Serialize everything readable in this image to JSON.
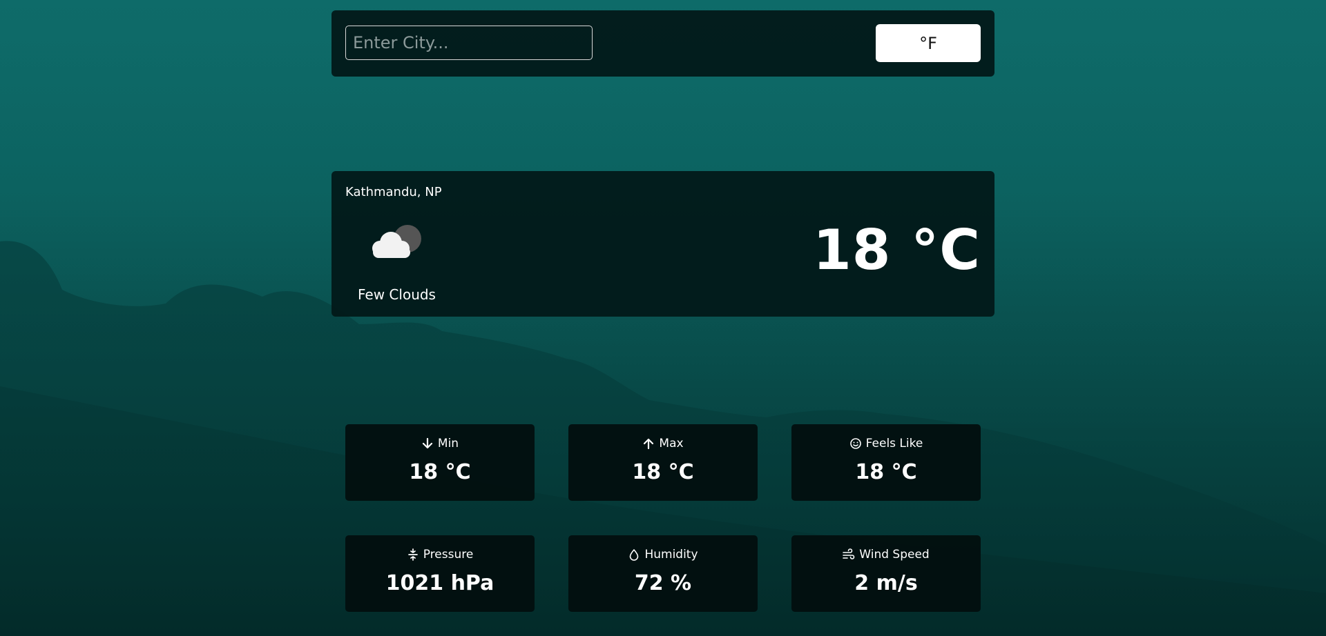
{
  "search": {
    "placeholder": "Enter City...",
    "value": ""
  },
  "unit_toggle": {
    "label": "°F"
  },
  "current": {
    "location": "Kathmandu, NP",
    "condition": "Few Clouds",
    "temperature": "18 °C",
    "icon": "few-clouds-night-icon"
  },
  "stats": [
    {
      "label": "Min",
      "value": "18 °C",
      "icon": "arrow-down-icon"
    },
    {
      "label": "Max",
      "value": "18 °C",
      "icon": "arrow-up-icon"
    },
    {
      "label": "Feels Like",
      "value": "18 °C",
      "icon": "smiley-icon"
    },
    {
      "label": "Pressure",
      "value": "1021 hPa",
      "icon": "pressure-icon"
    },
    {
      "label": "Humidity",
      "value": "72 %",
      "icon": "droplet-icon"
    },
    {
      "label": "Wind Speed",
      "value": "2 m/s",
      "icon": "wind-icon"
    }
  ],
  "colors": {
    "background": "#0c6462",
    "card": "#021818",
    "text": "#ffffff"
  }
}
